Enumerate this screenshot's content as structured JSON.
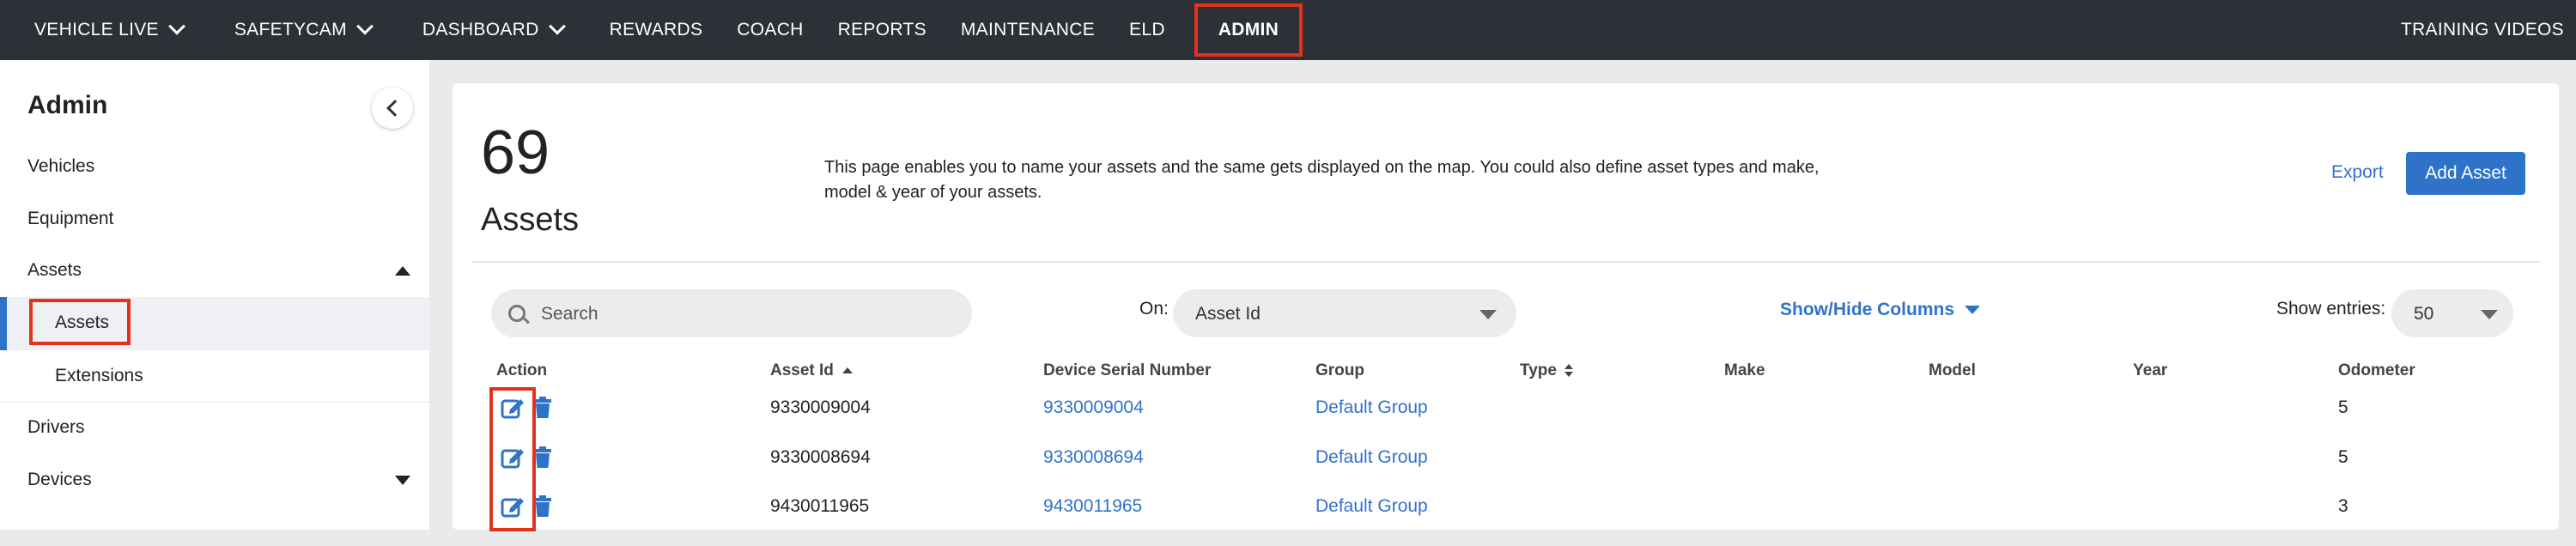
{
  "nav": {
    "items": [
      {
        "label": "VEHICLE LIVE",
        "dropdown": true
      },
      {
        "label": "SAFETYCAM",
        "dropdown": true
      },
      {
        "label": "DASHBOARD",
        "dropdown": true
      },
      {
        "label": "REWARDS",
        "dropdown": false
      },
      {
        "label": "COACH",
        "dropdown": false
      },
      {
        "label": "REPORTS",
        "dropdown": false
      },
      {
        "label": "MAINTENANCE",
        "dropdown": false
      },
      {
        "label": "ELD",
        "dropdown": false
      }
    ],
    "admin_label": "ADMIN",
    "training_label": "TRAINING VIDEOS"
  },
  "sidebar": {
    "title": "Admin",
    "items": [
      {
        "label": "Vehicles"
      },
      {
        "label": "Equipment"
      },
      {
        "label": "Assets"
      },
      {
        "label": "Assets"
      },
      {
        "label": "Extensions"
      },
      {
        "label": "Drivers"
      },
      {
        "label": "Devices"
      }
    ]
  },
  "main": {
    "count": "69",
    "count_label": "Assets",
    "description": "This page enables you to name your assets and the same gets displayed on the map. You could also define asset types and make, model & year of your assets.",
    "export_label": "Export",
    "add_label": "Add Asset"
  },
  "filters": {
    "search_placeholder": "Search",
    "on_label": "On:",
    "on_value": "Asset Id",
    "showhide_label": "Show/Hide Columns",
    "entries_label": "Show entries:",
    "entries_value": "50"
  },
  "table": {
    "columns": [
      "Action",
      "Asset Id",
      "Device Serial Number",
      "Group",
      "Type",
      "Make",
      "Model",
      "Year",
      "Odometer"
    ],
    "rows": [
      {
        "asset_id": "9330009004",
        "serial": "9330009004",
        "group": "Default Group",
        "type": "",
        "make": "",
        "model": "",
        "year": "",
        "odometer": "5"
      },
      {
        "asset_id": "9330008694",
        "serial": "9330008694",
        "group": "Default Group",
        "type": "",
        "make": "",
        "model": "",
        "year": "",
        "odometer": "5"
      },
      {
        "asset_id": "9430011965",
        "serial": "9430011965",
        "group": "Default Group",
        "type": "",
        "make": "",
        "model": "",
        "year": "",
        "odometer": "3"
      }
    ]
  },
  "colors": {
    "accent": "#2f73c9",
    "topbar": "#2d3036",
    "highlight": "#e2321d"
  }
}
